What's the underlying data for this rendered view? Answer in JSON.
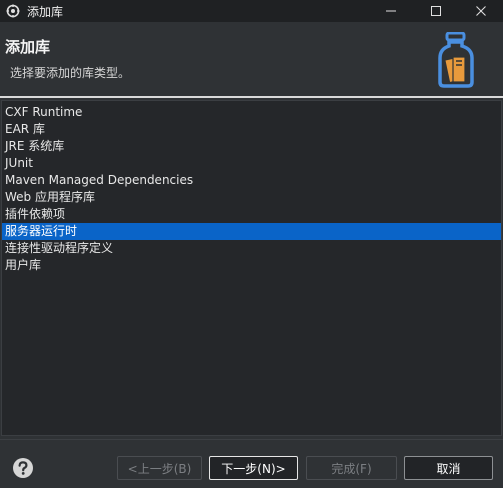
{
  "window": {
    "title": "添加库",
    "controls": [
      "minimize-icon",
      "maximize-icon",
      "close-icon"
    ]
  },
  "header": {
    "title": "添加库",
    "description": "选择要添加的库类型。",
    "graphic": "library-jar-icon"
  },
  "library_list": {
    "items": [
      "CXF Runtime",
      "EAR 库",
      "JRE 系统库",
      "JUnit",
      "Maven Managed Dependencies",
      "Web 应用程序库",
      "插件依赖项",
      "服务器运行时",
      "连接性驱动程序定义",
      "用户库"
    ],
    "selected": "服务器运行时"
  },
  "footer": {
    "help_icon": "question-mark-icon",
    "back_label": "<上一步(B)",
    "next_label": "下一步(N)>",
    "finish_label": "完成(F)",
    "cancel_label": "取消"
  },
  "colors": {
    "background": "#2f3235",
    "titlebar": "#1f2123",
    "list_background": "#25272a",
    "selection": "#0a64c8",
    "icon_blue": "#4a8fe0",
    "icon_orange": "#e89a3c"
  }
}
